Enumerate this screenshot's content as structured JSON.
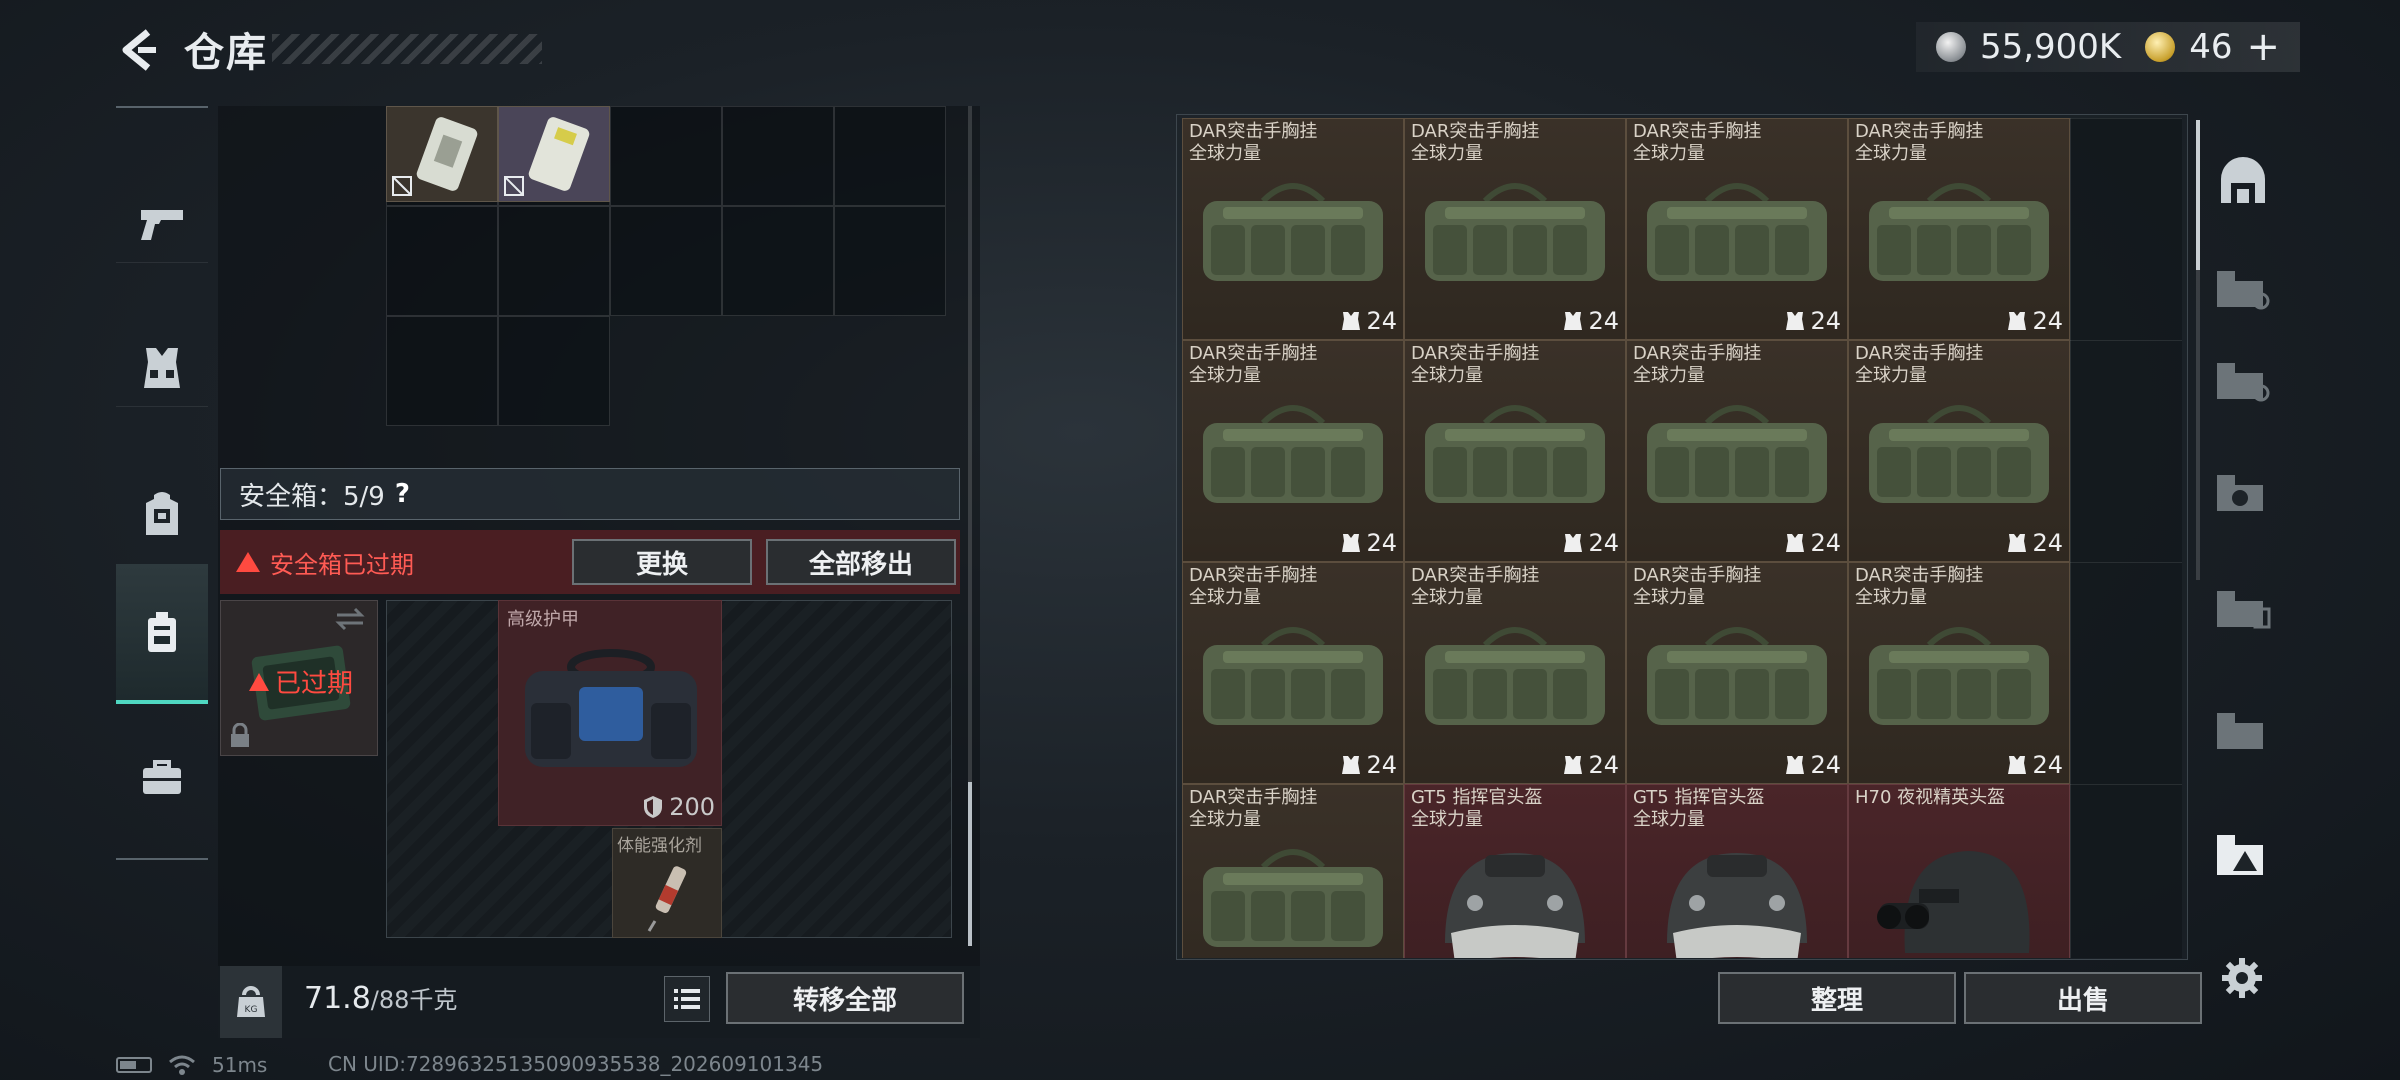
{
  "header": {
    "title": "仓库",
    "currency_silver": "55,900K",
    "currency_gold": "46",
    "currency_add": "+"
  },
  "left_nav": {
    "items": [
      {
        "name": "weapons",
        "icon": "pistol-icon"
      },
      {
        "name": "chest-rig",
        "icon": "vest-icon"
      },
      {
        "name": "backpack",
        "icon": "backpack-icon"
      },
      {
        "name": "safebox",
        "icon": "safebox-icon",
        "active": true
      },
      {
        "name": "toolbox",
        "icon": "briefcase-icon"
      }
    ]
  },
  "safebox": {
    "label": "安全箱：5/9",
    "help": "?",
    "expired_message": "安全箱已过期",
    "replace_button": "更换",
    "move_all_out_button": "全部移出",
    "case_status": "已过期",
    "armor_label": "高级护甲",
    "armor_durability": "200",
    "stim_label": "体能强化剂"
  },
  "weight": {
    "current": "71.8",
    "max": "/88千克",
    "icon_label": "KG"
  },
  "transfer_all_button": "转移全部",
  "storage": {
    "items": [
      {
        "name": "DAR突击手胸挂",
        "sub": "全球力量",
        "capacity": "24",
        "type": "rig"
      },
      {
        "name": "DAR突击手胸挂",
        "sub": "全球力量",
        "capacity": "24",
        "type": "rig"
      },
      {
        "name": "DAR突击手胸挂",
        "sub": "全球力量",
        "capacity": "24",
        "type": "rig"
      },
      {
        "name": "DAR突击手胸挂",
        "sub": "全球力量",
        "capacity": "24",
        "type": "rig"
      },
      {
        "name": "DAR突击手胸挂",
        "sub": "全球力量",
        "capacity": "24",
        "type": "rig"
      },
      {
        "name": "DAR突击手胸挂",
        "sub": "全球力量",
        "capacity": "24",
        "type": "rig"
      },
      {
        "name": "DAR突击手胸挂",
        "sub": "全球力量",
        "capacity": "24",
        "type": "rig"
      },
      {
        "name": "DAR突击手胸挂",
        "sub": "全球力量",
        "capacity": "24",
        "type": "rig"
      },
      {
        "name": "DAR突击手胸挂",
        "sub": "全球力量",
        "capacity": "24",
        "type": "rig"
      },
      {
        "name": "DAR突击手胸挂",
        "sub": "全球力量",
        "capacity": "24",
        "type": "rig"
      },
      {
        "name": "DAR突击手胸挂",
        "sub": "全球力量",
        "capacity": "24",
        "type": "rig"
      },
      {
        "name": "DAR突击手胸挂",
        "sub": "全球力量",
        "capacity": "24",
        "type": "rig"
      },
      {
        "name": "DAR突击手胸挂",
        "sub": "全球力量",
        "capacity": "",
        "type": "rig"
      },
      {
        "name": "GT5 指挥官头盔",
        "sub": "全球力量",
        "capacity": "",
        "type": "helmet"
      },
      {
        "name": "GT5 指挥官头盔",
        "sub": "全球力量",
        "capacity": "",
        "type": "helmet"
      },
      {
        "name": "H70 夜视精英头盔",
        "sub": "",
        "capacity": "",
        "type": "nvg-helmet"
      }
    ],
    "sort_button": "整理",
    "sell_button": "出售"
  },
  "status": {
    "ping": "51ms",
    "uid": "CN UID:7289632513509093​5538_202609101345"
  },
  "colors": {
    "accent": "#4fd7c1",
    "warning": "#ff4a40",
    "rig_tile": "#3a3128",
    "helmet_tile": "#4a2529"
  }
}
